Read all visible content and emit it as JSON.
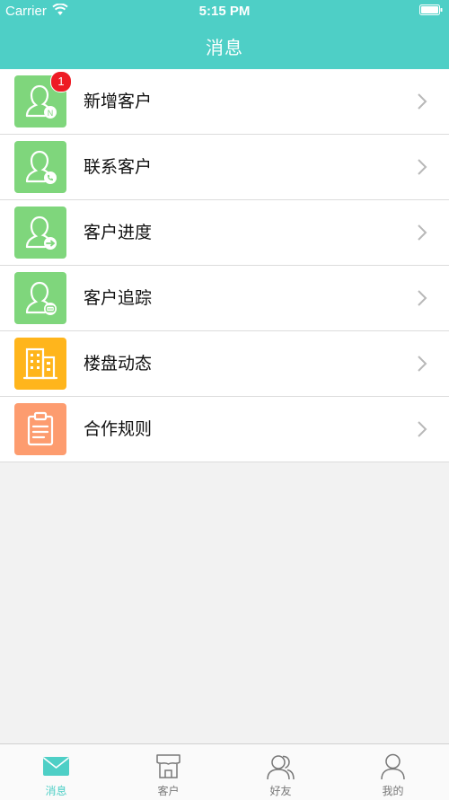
{
  "status_bar": {
    "carrier": "Carrier",
    "time": "5:15 PM",
    "wifi_icon": "wifi-icon",
    "battery_icon": "battery-icon"
  },
  "header": {
    "title": "消息",
    "background": "#4ecfc6"
  },
  "items": [
    {
      "label": "新增客户",
      "icon": "user-new-icon",
      "icon_color": "#7fd67c",
      "badge": "1"
    },
    {
      "label": "联系客户",
      "icon": "user-phone-icon",
      "icon_color": "#7fd67c"
    },
    {
      "label": "客户进度",
      "icon": "user-progress-icon",
      "icon_color": "#7fd67c"
    },
    {
      "label": "客户追踪",
      "icon": "user-chat-icon",
      "icon_color": "#7fd67c"
    },
    {
      "label": "楼盘动态",
      "icon": "building-icon",
      "icon_color": "#ffb51c"
    },
    {
      "label": "合作规则",
      "icon": "clipboard-icon",
      "icon_color": "#fd9c6f"
    }
  ],
  "tabs": [
    {
      "label": "消息",
      "icon": "mail-icon",
      "active": true
    },
    {
      "label": "客户",
      "icon": "customer-icon",
      "active": false
    },
    {
      "label": "好友",
      "icon": "friends-icon",
      "active": false
    },
    {
      "label": "我的",
      "icon": "profile-icon",
      "active": false
    }
  ],
  "colors": {
    "accent": "#4ecfc6",
    "badge": "#ee1b24",
    "inactive_tab": "#777777"
  }
}
